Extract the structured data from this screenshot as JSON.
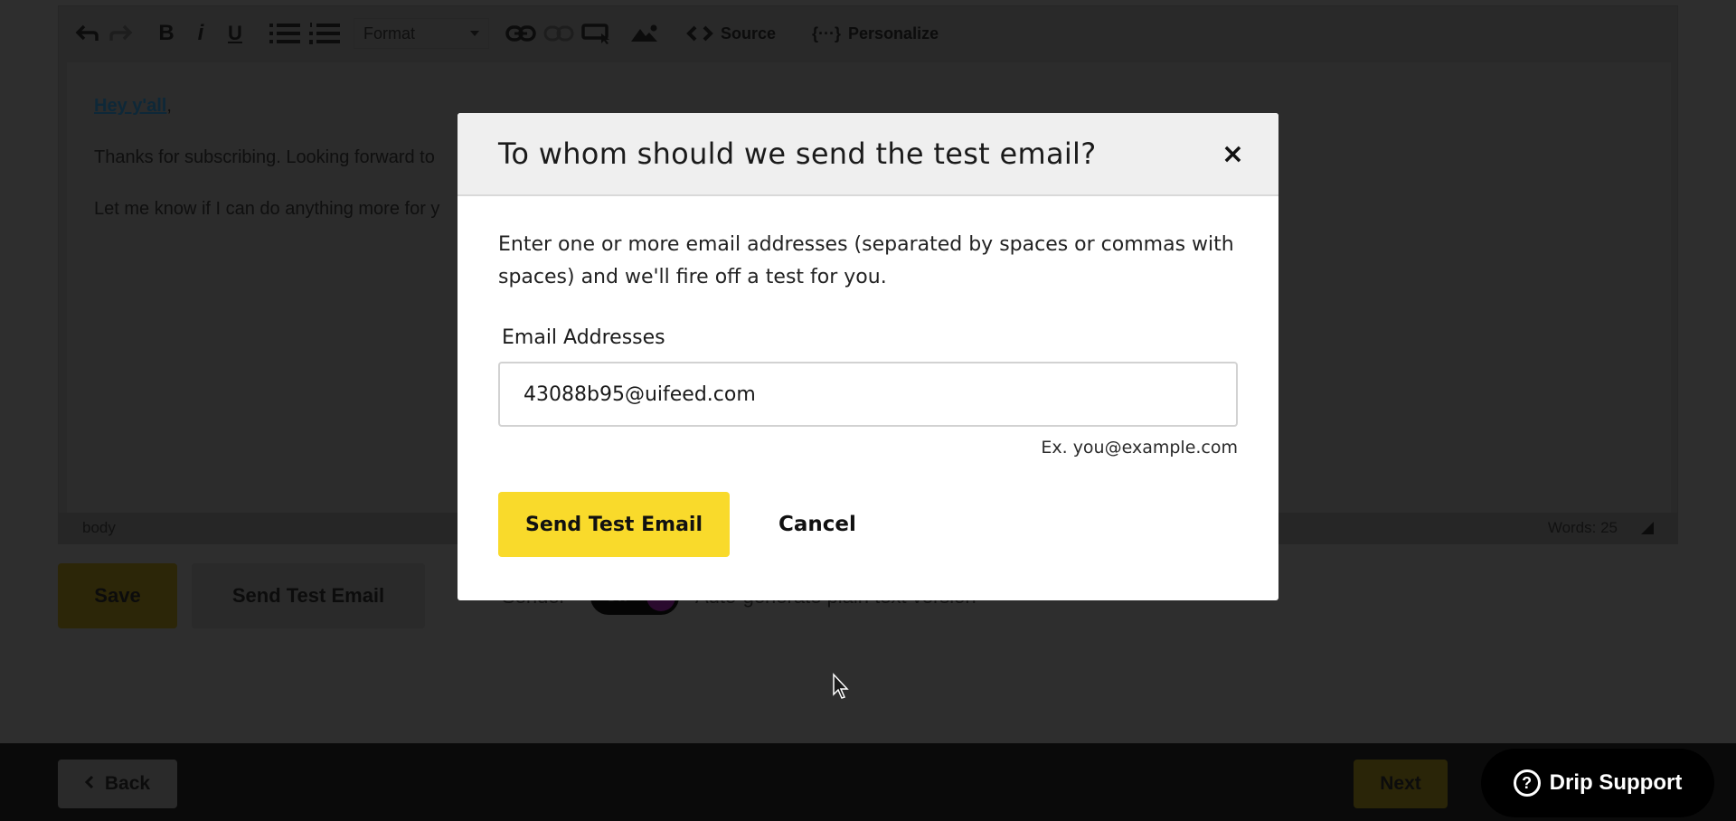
{
  "editor": {
    "toolbar": {
      "undo_icon": "undo-icon",
      "redo_icon": "redo-icon",
      "bold_icon": "bold-icon",
      "italic_icon": "italic-icon",
      "underline_icon": "underline-icon",
      "bullet_list_icon": "bullet-list-icon",
      "numbered_list_icon": "numbered-list-icon",
      "format_select": "Format",
      "link_icon": "link-icon",
      "unlink_icon": "unlink-icon",
      "button_icon": "insert-button-icon",
      "image_icon": "image-icon",
      "source_label": "Source",
      "personalize_label": "Personalize"
    },
    "content": {
      "greeting_link": "Hey y'all",
      "greeting_suffix": ",",
      "line2": "Thanks for subscribing. Looking forward to",
      "line3": "Let me know if I can do anything more for y"
    },
    "statusbar": {
      "path": "body",
      "words": "Words: 25"
    }
  },
  "actions": {
    "save_label": "Save",
    "send_test_label": "Send Test Email",
    "toggle_label": "Sender",
    "toggle_state": "On",
    "toggle_text": "Auto-generate plain text version"
  },
  "footer": {
    "back_label": "Back",
    "next_label": "Next",
    "support_label": "Drip Support"
  },
  "modal": {
    "title": "To whom should we send the test email?",
    "close_symbol": "×",
    "description": "Enter one or more email addresses (separated by spaces or commas with spaces) and we'll fire off a test for you.",
    "field_label": "Email Addresses",
    "email_value": "43088b95@uifeed.com",
    "hint": "Ex. you@example.com",
    "send_label": "Send Test Email",
    "cancel_label": "Cancel",
    "accent_color": "#f9da2b"
  }
}
